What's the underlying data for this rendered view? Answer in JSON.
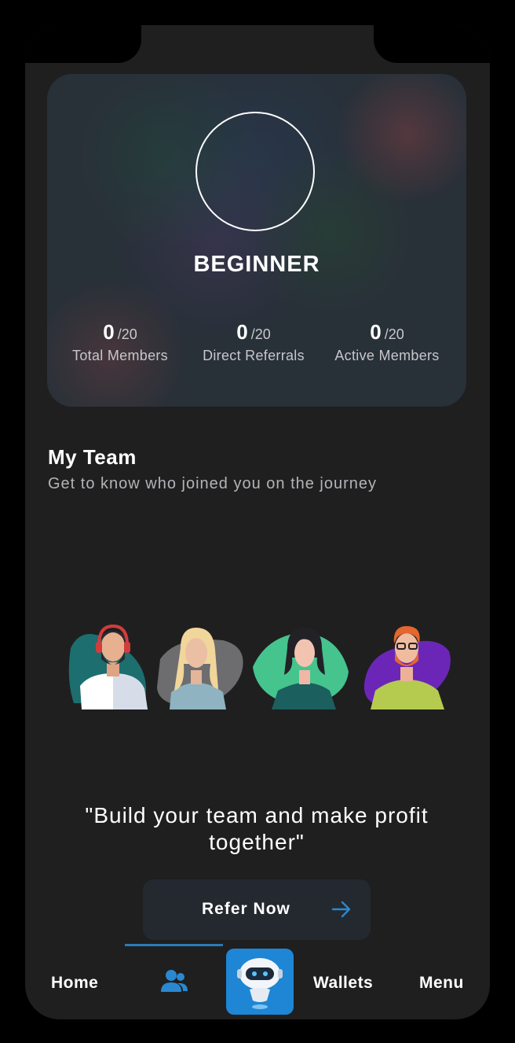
{
  "rank": {
    "title": "BEGINNER"
  },
  "stats": [
    {
      "value": "0",
      "max": "/20",
      "label": "Total Members"
    },
    {
      "value": "0",
      "max": "/20",
      "label": "Direct Referrals"
    },
    {
      "value": "0",
      "max": "/20",
      "label": "Active Members"
    }
  ],
  "team": {
    "title": "My Team",
    "subtitle": "Get to know who joined you on the journey"
  },
  "quote": "\"Build your team and make profit together\"",
  "refer": {
    "label": "Refer Now",
    "icon": "arrow-right-icon"
  },
  "nav": {
    "home": "Home",
    "team_icon": "team-icon",
    "bot_icon": "robot-icon",
    "wallets": "Wallets",
    "menu": "Menu"
  },
  "colors": {
    "accent": "#1e86d4",
    "background": "#1f1f20",
    "button": "#23292f"
  }
}
